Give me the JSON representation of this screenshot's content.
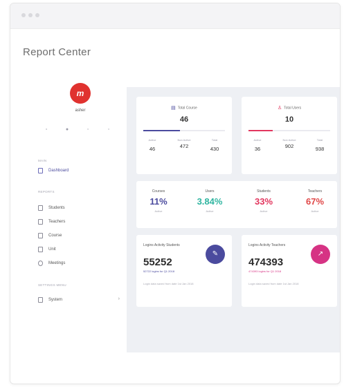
{
  "window": {
    "title": "Report Center"
  },
  "colors": {
    "brand": "#e0322f",
    "indigo": "#4b4b9e",
    "teal": "#2fb5a0",
    "pink": "#e2365e",
    "red": "#e04848",
    "magenta": "#d63384"
  },
  "sidebar": {
    "logo_text": "m",
    "user_name": "asher",
    "top_icons": [
      "grid-icon",
      "circle-icon",
      "user-icon",
      "settings-icon"
    ],
    "section_main": "Main",
    "dashboard": "Dashboard",
    "section_reports": "Reports",
    "items": [
      "Students",
      "Teachers",
      "Course",
      "Unit",
      "Meetings"
    ],
    "section_settings": "Settings menu",
    "system": "System"
  },
  "cards": {
    "course": {
      "title": "Total Course",
      "total": "46",
      "progress": 0.45,
      "sub": [
        {
          "label": "Active",
          "value": "46"
        },
        {
          "label": "Non Active",
          "value": "472"
        },
        {
          "label": "Total",
          "value": "430"
        }
      ]
    },
    "users": {
      "title": "Total Users",
      "total": "10",
      "progress": 0.3,
      "sub": [
        {
          "label": "Active",
          "value": "36"
        },
        {
          "label": "Non Active",
          "value": "902"
        },
        {
          "label": "Total",
          "value": "938"
        }
      ]
    }
  },
  "stats": [
    {
      "label": "Courses",
      "value": "11%",
      "sub": "Active"
    },
    {
      "label": "Users",
      "value": "3.84%",
      "sub": "Active"
    },
    {
      "label": "Students",
      "value": "33%",
      "sub": "Active"
    },
    {
      "label": "Teachers",
      "value": "67%",
      "sub": "Active"
    }
  ],
  "logins": [
    {
      "title": "Logins Activity Students",
      "value": "55252",
      "link": "52722 logins for Q1 2018",
      "note": "Login data saved from date 1st Jan 2018"
    },
    {
      "title": "Logins Activity Teachers",
      "value": "474393",
      "link": "474393 logins for Q1 2018",
      "note": "Login data saved from date 1st Jan 2018"
    }
  ]
}
